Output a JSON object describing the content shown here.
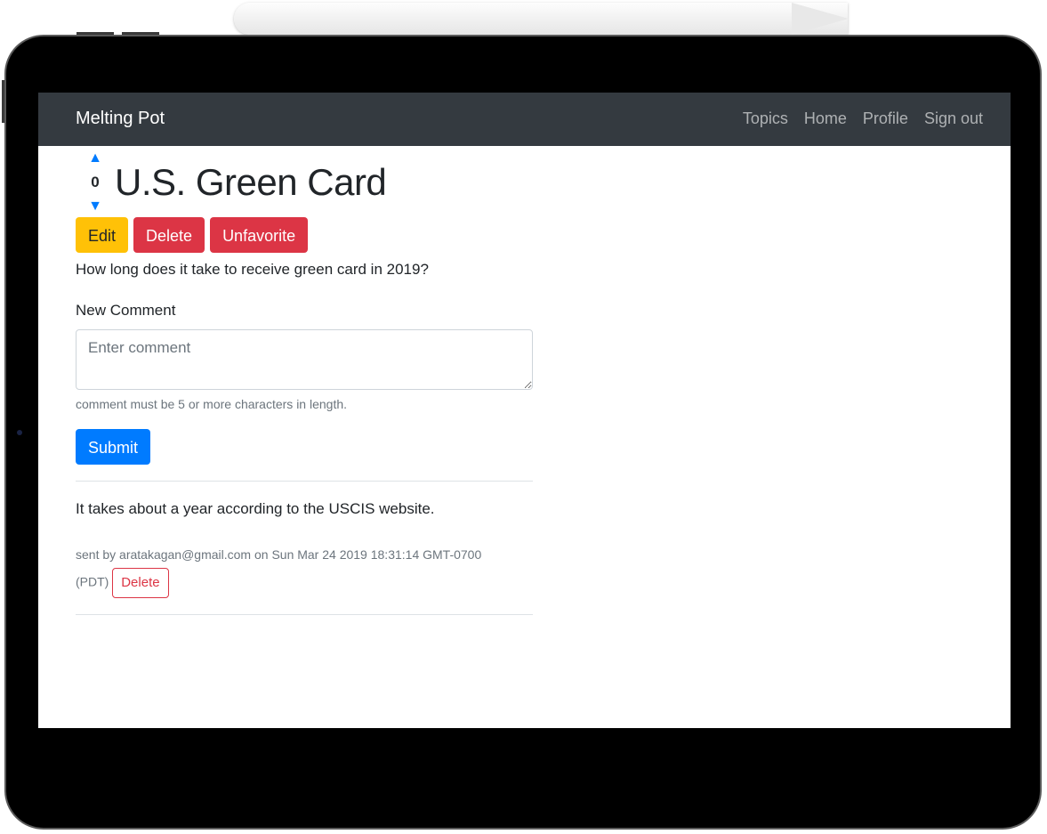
{
  "navbar": {
    "brand": "Melting Pot",
    "links": [
      "Topics",
      "Home",
      "Profile",
      "Sign out"
    ]
  },
  "topic": {
    "vote_count": "0",
    "title": "U.S. Green Card",
    "description": "How long does it take to receive green card in 2019?"
  },
  "actions": {
    "edit": "Edit",
    "delete": "Delete",
    "unfavorite": "Unfavorite"
  },
  "comment_form": {
    "label": "New Comment",
    "placeholder": "Enter comment",
    "help": "comment must be 5 or more characters in length.",
    "submit": "Submit"
  },
  "comments": [
    {
      "text": "It takes about a year according to the USCIS website.",
      "meta_line1": "sent by aratakagan@gmail.com on Sun Mar 24 2019 18:31:14 GMT-0700",
      "meta_line2": "(PDT)",
      "delete": "Delete"
    }
  ],
  "colors": {
    "navbar_bg": "#343a40",
    "primary": "#007bff",
    "warning": "#ffc107",
    "danger": "#dc3545"
  }
}
